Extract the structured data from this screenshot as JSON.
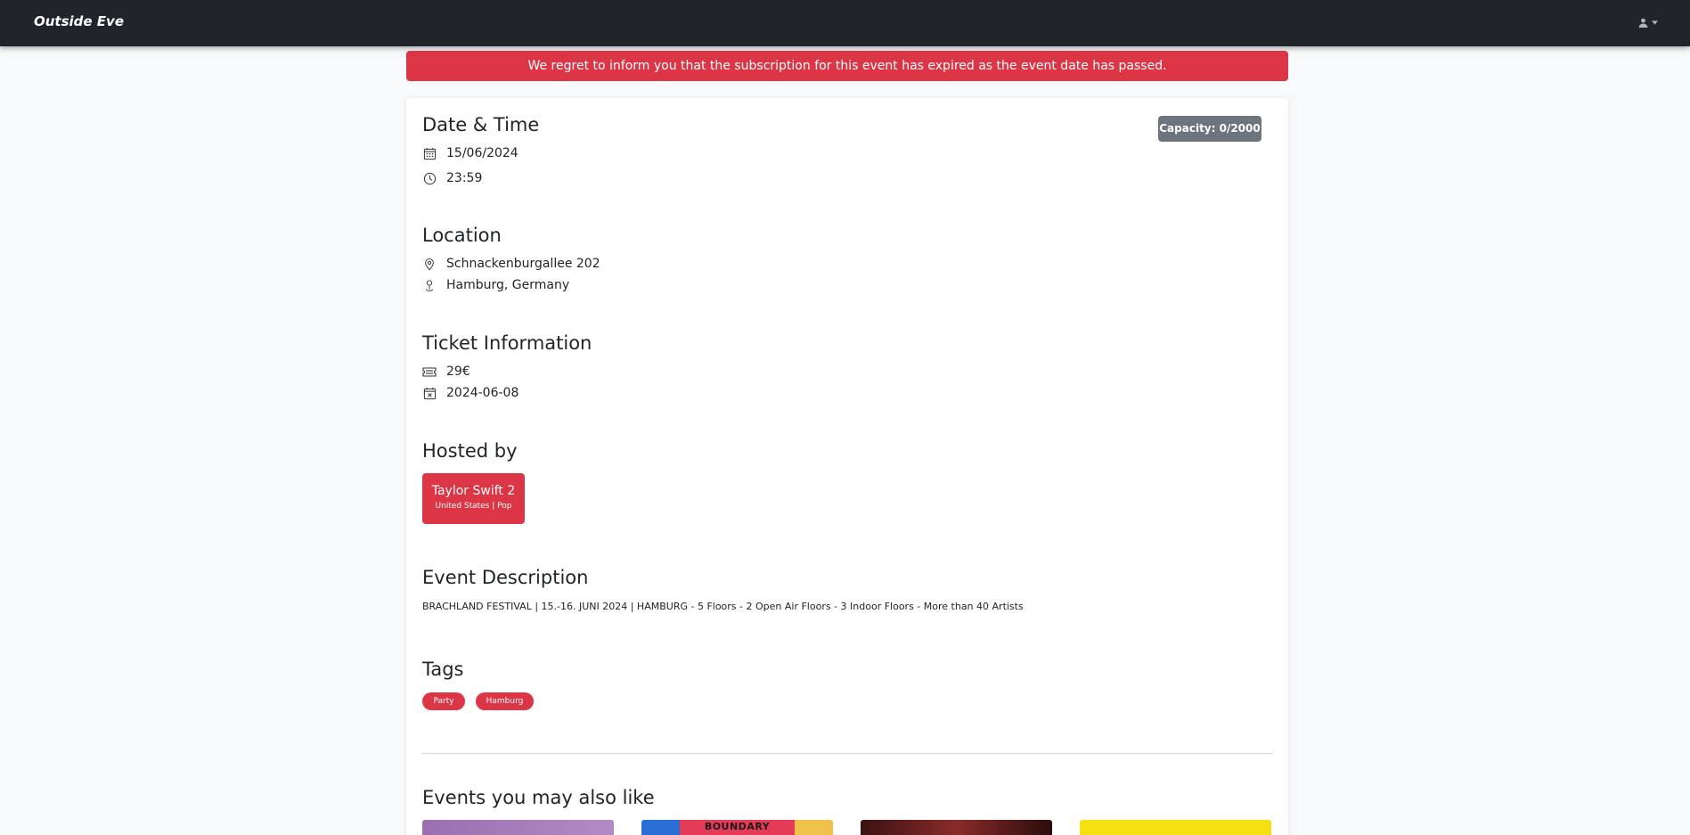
{
  "navbar": {
    "brand": "Outside Eve"
  },
  "alert": {
    "message": "We regret to inform you that the subscription for this event has expired as the event date has passed."
  },
  "event": {
    "capacity": "Capacity: 0/2000",
    "date_time": {
      "heading": "Date & Time",
      "date": "15/06/2024",
      "time": "23:59"
    },
    "location": {
      "heading": "Location",
      "street": "Schnackenburgallee 202",
      "city": "Hamburg, Germany"
    },
    "ticket": {
      "heading": "Ticket Information",
      "price": "29€",
      "sale_end": "2024-06-08"
    },
    "hosted_by": {
      "heading": "Hosted by",
      "name": "Taylor Swift 2",
      "subtitle": "United States | Pop"
    },
    "description": {
      "heading": "Event Description",
      "text": "BRACHLAND FESTIVAL | 15.-16. JUNI 2024 | HAMBURG - 5 Floors - 2 Open Air Floors - 3 Indoor Floors - More than 40 Artists"
    },
    "tags": {
      "heading": "Tags",
      "items": [
        "Party",
        "Hamburg"
      ]
    }
  },
  "related": {
    "heading": "Events you may also like",
    "thumb_2_text": "BOUNDARY"
  },
  "icons": {
    "user": "user-icon",
    "caret": "caret-down-icon",
    "calendar": "calendar-icon",
    "clock": "clock-icon",
    "location": "geo-pin-icon",
    "city": "map-pin-icon",
    "ticket": "ticket-icon",
    "calendar_x": "calendar-x-icon"
  },
  "colors": {
    "danger": "#dc3545",
    "navbar": "#212529",
    "secondary": "#6c757d"
  }
}
